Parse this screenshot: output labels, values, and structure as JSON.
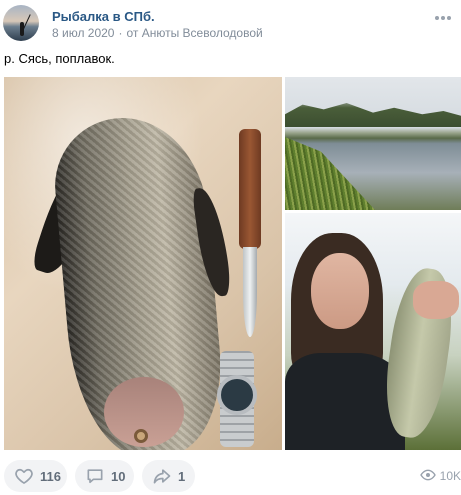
{
  "post": {
    "group_name": "Рыбалка в СПб.",
    "date": "8 июл 2020",
    "separator": "·",
    "author_credit": "от Анюты Всеволодовой",
    "text": "р. Сясь, поплавок."
  },
  "actions": {
    "likes": "116",
    "comments": "10",
    "shares": "1",
    "views": "10K"
  },
  "icons": {
    "like": "heart-icon",
    "comment": "comment-icon",
    "share": "share-icon",
    "views": "eye-icon",
    "more": "more-dots-icon"
  },
  "colors": {
    "link": "#2a5885",
    "meta": "#818c99",
    "button_bg": "#f2f3f5",
    "icon": "#99a2ad"
  }
}
